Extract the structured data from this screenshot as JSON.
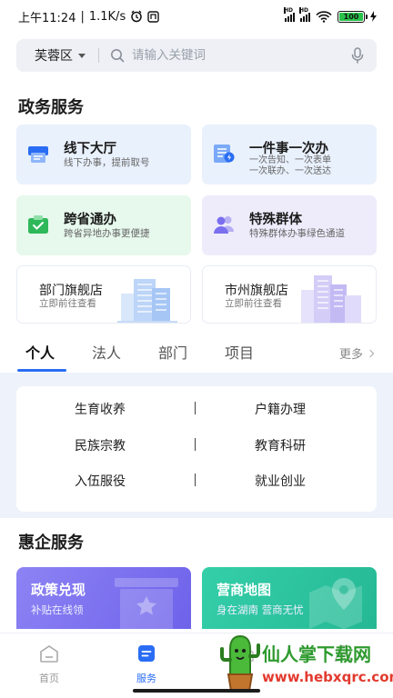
{
  "status_bar": {
    "time": "上午11:24",
    "speed": "1.1K/s",
    "battery": "100"
  },
  "search": {
    "region": "芙蓉区",
    "placeholder": "请输入关键词"
  },
  "gov_services": {
    "title": "政务服务",
    "cards": [
      {
        "title": "线下大厅",
        "subtitle": "线下办事，提前取号"
      },
      {
        "title": "一件事一次办",
        "subtitle_lines": [
          "一次告知、一次表单",
          "一次联办、一次送达"
        ]
      },
      {
        "title": "跨省通办",
        "subtitle": "跨省异地办事更便捷"
      },
      {
        "title": "特殊群体",
        "subtitle": "特殊群体办事绿色通道"
      }
    ],
    "stores": [
      {
        "title": "部门旗舰店",
        "subtitle": "立即前往查看"
      },
      {
        "title": "市州旗舰店",
        "subtitle": "立即前往查看"
      }
    ]
  },
  "tabs": {
    "items": [
      "个人",
      "法人",
      "部门",
      "项目"
    ],
    "active": "个人",
    "more": "更多"
  },
  "personal_services": [
    "生育收养",
    "户籍办理",
    "民族宗教",
    "教育科研",
    "入伍服役",
    "就业创业"
  ],
  "enterprise": {
    "title": "惠企服务",
    "cards": [
      {
        "title": "政策兑现",
        "subtitle": "补贴在线领"
      },
      {
        "title": "营商地图",
        "subtitle": "身在湖南 营商无忧"
      }
    ]
  },
  "bottom_nav": {
    "items": [
      "首页",
      "服务"
    ],
    "active": "服务"
  },
  "watermark": {
    "text": "仙人掌下载网",
    "url": "www.hebxqrc.com"
  },
  "colors": {
    "accent": "#2a6df4",
    "policy_card": "#7b6ff0",
    "map_card": "#2cc4a0"
  }
}
